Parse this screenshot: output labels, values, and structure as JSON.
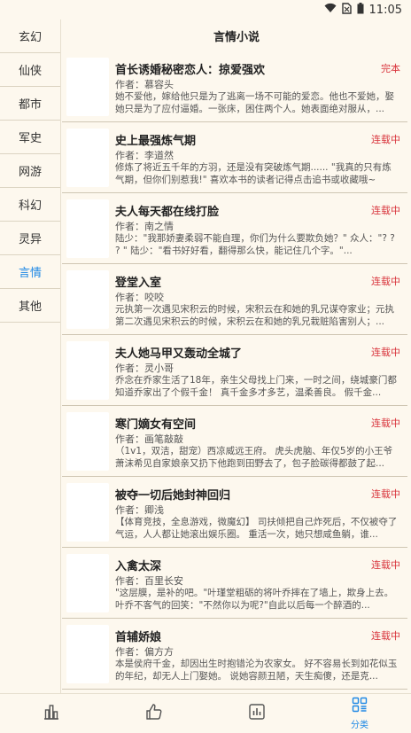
{
  "status_bar": {
    "time": "11:05"
  },
  "header": {
    "title": "言情小说"
  },
  "sidebar": {
    "items": [
      {
        "label": "玄幻",
        "active": false
      },
      {
        "label": "仙侠",
        "active": false
      },
      {
        "label": "都市",
        "active": false
      },
      {
        "label": "军史",
        "active": false
      },
      {
        "label": "网游",
        "active": false
      },
      {
        "label": "科幻",
        "active": false
      },
      {
        "label": "灵异",
        "active": false
      },
      {
        "label": "言情",
        "active": true
      },
      {
        "label": "其他",
        "active": false
      }
    ]
  },
  "books": [
    {
      "title": "首长诱婚秘密恋人：掠爱强欢",
      "status": "完本",
      "author": "作者：慕容头",
      "desc": "她不爱他，嫁给他只是为了逃离一场不可能的爱恋。他也不爱她，娶她只是为了应付逼婚。一张床，困住两个人。她表面绝对服从，..."
    },
    {
      "title": "史上最强炼气期",
      "status": "连载中",
      "author": "作者：李道然",
      "desc": "修炼了将近五千年的方羽，还是没有突破炼气期...... \"我真的只有炼气期，但你们别惹我!\" 喜欢本书的读者记得点击追书或收藏哦~"
    },
    {
      "title": "夫人每天都在线打脸",
      "status": "连载中",
      "author": "作者：南之情",
      "desc": "陆少：\"我那娇妻柔弱不能自理，你们为什么要欺负她？\" 众人：\"? ? ? \" 陆少：\"看书好好看，翻得那么快，能记住几个字。\"..."
    },
    {
      "title": "登堂入室",
      "status": "连载中",
      "author": "作者：咬咬",
      "desc": "元执第一次遇见宋积云的时候，宋积云在和她的乳兄谋夺家业；元执第二次遇见宋积云的时候，宋积云在和她的乳兄栽赃陷害别人；..."
    },
    {
      "title": "夫人她马甲又轰动全城了",
      "status": "连载中",
      "author": "作者：灵小哥",
      "desc": "乔念在乔家生活了18年，亲生父母找上门来，一时之间，绕城豪门都知道乔家出了个假千金！ 真千金多才多艺，温柔善良。 假千金..."
    },
    {
      "title": "寒门嫡女有空间",
      "status": "连载中",
      "author": "作者：画笔敲敲",
      "desc": "（1v1，双洁，甜宠）西凉威远王府。 虎头虎脑、年仅5岁的小王爷萧沫希见自家娘亲又扔下他跑到田野去了，包子脸碳得都鼓了起..."
    },
    {
      "title": "被夺一切后她封神回归",
      "status": "连载中",
      "author": "作者：卿浅",
      "desc": "【体育竞技，全息游戏，微魔幻】 司扶倾把自己炸死后，不仅被夺了气运，人人都让她滚出娱乐圈。 重活一次，她只想咸鱼躺，谁..."
    },
    {
      "title": "入禽太深",
      "status": "连载中",
      "author": "作者：百里长安",
      "desc": "\"这层膜，是补的吧。\"叶瑾堂粗砺的将叶乔摔在了墙上，欺身上去。 叶乔不客气的回笑：\"不然你以为呢?\"自此以后每一个醉酒的..."
    },
    {
      "title": "首辅娇娘",
      "status": "连载中",
      "author": "作者：偏方方",
      "desc": "本是侯府千金，却因出生时抱错沦为农家女。 好不容易长到如花似玉的年纪，却无人上门娶她。 说她容颜丑陋，天生痴傻，还是克..."
    }
  ],
  "bottom_tabs": [
    {
      "icon": "ranking-icon",
      "label": "",
      "active": false
    },
    {
      "icon": "thumbs-up-icon",
      "label": "",
      "active": false
    },
    {
      "icon": "chart-icon",
      "label": "",
      "active": false
    },
    {
      "icon": "category-icon",
      "label": "分类",
      "active": true
    }
  ],
  "colors": {
    "background": "#fdf8ee",
    "accent": "#1e88e5",
    "status": "#d9363e"
  }
}
